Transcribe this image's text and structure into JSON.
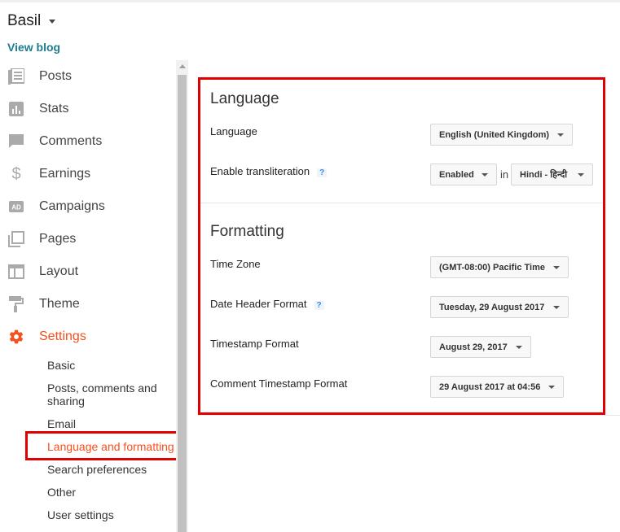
{
  "header": {
    "blog_name": "Basil",
    "view_blog": "View blog"
  },
  "sidebar": {
    "items": [
      {
        "label": "Posts",
        "icon": "posts-icon"
      },
      {
        "label": "Stats",
        "icon": "stats-icon"
      },
      {
        "label": "Comments",
        "icon": "comments-icon"
      },
      {
        "label": "Earnings",
        "icon": "dollar-icon"
      },
      {
        "label": "Campaigns",
        "icon": "ad-icon"
      },
      {
        "label": "Pages",
        "icon": "pages-icon"
      },
      {
        "label": "Layout",
        "icon": "layout-icon"
      },
      {
        "label": "Theme",
        "icon": "paint-roller-icon"
      },
      {
        "label": "Settings",
        "icon": "gear-icon"
      }
    ],
    "settings_sub": [
      "Basic",
      "Posts, comments and sharing",
      "Email",
      "Language and formatting",
      "Search preferences",
      "Other",
      "User settings"
    ]
  },
  "language_section": {
    "title": "Language",
    "language_label": "Language",
    "language_value": "English (United Kingdom)",
    "translit_label": "Enable transliteration",
    "translit_help": "?",
    "translit_value": "Enabled",
    "in_word": "in",
    "translit_lang": "Hindi - हिन्दी"
  },
  "formatting_section": {
    "title": "Formatting",
    "timezone_label": "Time Zone",
    "timezone_value": "(GMT-08:00) Pacific Time",
    "date_header_label": "Date Header Format",
    "date_header_help": "?",
    "date_header_value": "Tuesday, 29 August 2017",
    "timestamp_label": "Timestamp Format",
    "timestamp_value": "August 29, 2017",
    "comment_ts_label": "Comment Timestamp Format",
    "comment_ts_value": "29 August 2017 at 04:56"
  },
  "colors": {
    "accent": "#f4511e",
    "highlight_box": "#e00000",
    "link": "#1e7c8e"
  }
}
